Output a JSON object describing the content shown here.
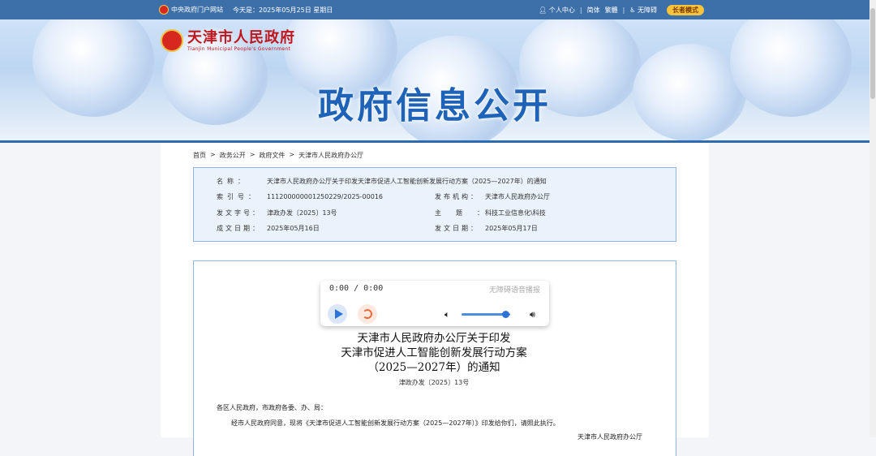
{
  "topbar": {
    "portal": "中央政府门户网站",
    "date_text": "今天是：2025年05月25日 星期日",
    "personal_center": "个人中心",
    "simplified": "简体",
    "traditional": "繁體",
    "accessible": "无障碍",
    "elderly_mode": "长者模式"
  },
  "header": {
    "site_name_cn": "天津市人民政府",
    "site_name_en": "Tianjin Municipal People's Government",
    "banner_title": "政府信息公开"
  },
  "breadcrumb": [
    "首页",
    "政务公开",
    "政府文件",
    "天津市人民政府办公厅"
  ],
  "breadcrumb_sep": ">",
  "info": {
    "name_label": "名称：",
    "name_value": "天津市人民政府办公厅关于印发天津市促进人工智能创新发展行动方案（2025—2027年）的通知",
    "index_label": "索引号：",
    "index_value": "111200000001250229/2025-00016",
    "issuer_label": "发布机构：",
    "issuer_value": "天津市人民政府办公厅",
    "docno_label": "发文字号：",
    "docno_value": "津政办发〔2025〕13号",
    "topic_label": "主题：",
    "topic_value": "科技工业信息化\\科技",
    "written_label": "成文日期：",
    "written_value": "2025年05月16日",
    "published_label": "发文日期：",
    "published_value": "2025年05月17日"
  },
  "player": {
    "time": "0:00 / 0:00",
    "hint": "无障碍语音播报",
    "volume": 0.9
  },
  "document": {
    "title_line1": "天津市人民政府办公厅关于印发",
    "title_line2": "天津市促进人工智能创新发展行动方案",
    "title_line3": "（2025—2027年）的通知",
    "doc_number": "津政办发〔2025〕13号",
    "salutation": "各区人民政府，市政府各委、办、局：",
    "body": "经市人民政府同意，现将《天津市促进人工智能创新发展行动方案（2025—2027年）》印发给你们，请照此执行。",
    "signature": "天津市人民政府办公厅"
  }
}
